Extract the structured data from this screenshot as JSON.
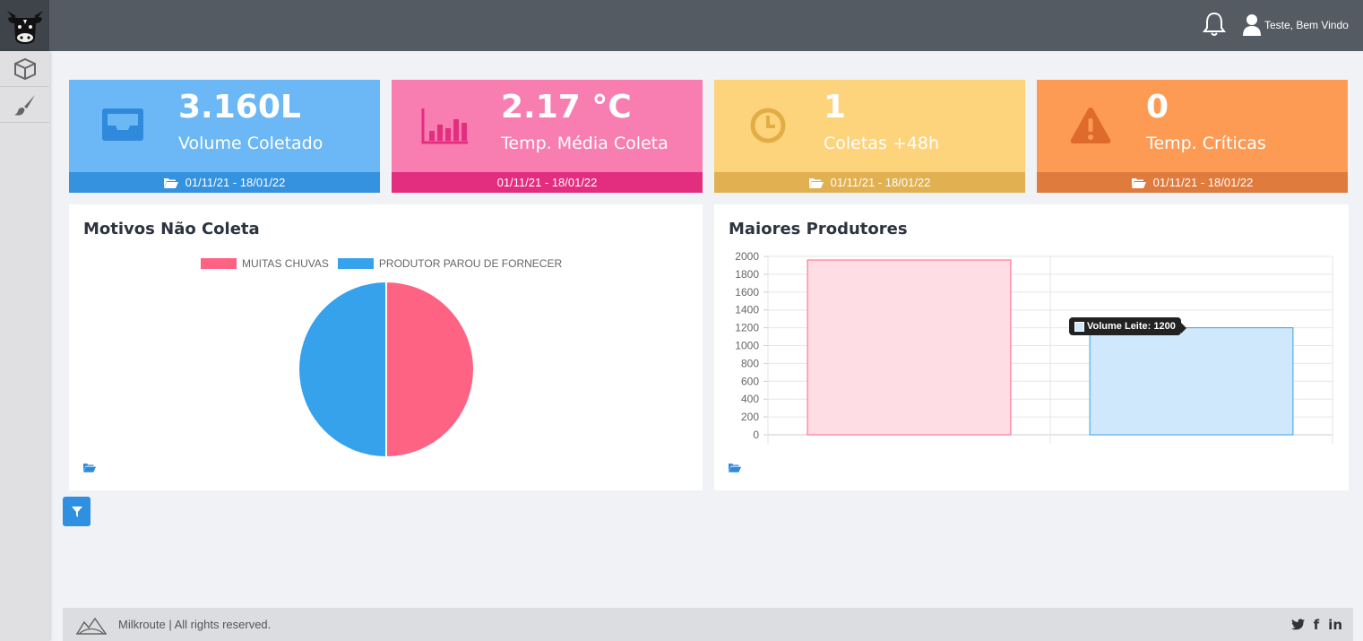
{
  "header": {
    "user_greeting": "Teste, Bem Vindo",
    "icons": [
      "cow-logo-icon",
      "bell-icon",
      "user-icon"
    ]
  },
  "sidebar": {
    "items": [
      {
        "icon": "cube-icon"
      },
      {
        "icon": "paintbrush-icon"
      }
    ]
  },
  "stats": [
    {
      "value": "3.160L",
      "label": "Volume Coletado",
      "period": "01/11/21 - 18/01/22",
      "icon": "inbox-icon",
      "color": "#6cb8f6",
      "foot_color": "#3592df",
      "icon_color": "#2f8adb"
    },
    {
      "value": "2.17 °C",
      "label": "Temp. Média Coleta",
      "period": "01/11/21 - 18/01/22",
      "icon": "bar-chart-icon",
      "color": "#f87eb2",
      "foot_color": "#e32d7f",
      "icon_color": "#e32d7f"
    },
    {
      "value": "1",
      "label": "Coletas +48h",
      "period": "01/11/21 - 18/01/22",
      "icon": "clock-icon",
      "color": "#fdd37b",
      "foot_color": "#e1b051",
      "icon_color": "#e3ad46"
    },
    {
      "value": "0",
      "label": "Temp. Críticas",
      "period": "01/11/21 - 18/01/22",
      "icon": "warning-icon",
      "color": "#fd9b55",
      "foot_color": "#df7b3c",
      "icon_color": "#de6a2c"
    }
  ],
  "panels": {
    "reasons_title": "Motivos Não Coleta",
    "producers_title": "Maiores Produtores"
  },
  "chart_data": [
    {
      "type": "pie",
      "title": "Motivos Não Coleta",
      "categories": [
        "MUITAS CHUVAS",
        "PRODUTOR PAROU DE FORNECER"
      ],
      "values": [
        1,
        1
      ],
      "colors": [
        "#ff6384",
        "#36a2eb"
      ],
      "legend": "top"
    },
    {
      "type": "bar",
      "title": "Maiores Produtores",
      "categories": [
        "",
        ""
      ],
      "series": [
        {
          "name": "Volume Leite",
          "values": [
            1960,
            1200
          ],
          "colors": [
            "#ffdde4",
            "#cfe8fb"
          ],
          "borders": [
            "#ff6384",
            "#36a2eb"
          ]
        }
      ],
      "ylim": [
        0,
        2000
      ],
      "yticks": [
        0,
        200,
        400,
        600,
        800,
        1000,
        1200,
        1400,
        1600,
        1800,
        2000
      ],
      "grid": true,
      "tooltip": "Volume Leite: 1200"
    }
  ],
  "filter_button": {
    "icon": "filter-icon"
  },
  "footer": {
    "text": "Milkroute | All rights reserved.",
    "social": [
      "twitter-icon",
      "facebook-icon",
      "linkedin-icon"
    ]
  }
}
